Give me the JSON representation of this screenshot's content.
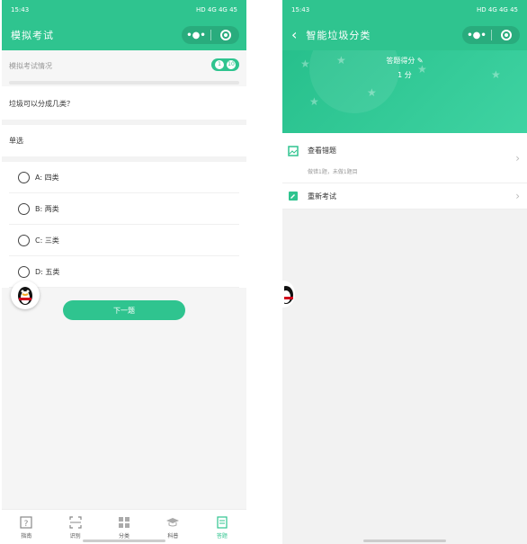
{
  "left": {
    "status_time": "15:43",
    "status_right": "HD 4G 4G 45",
    "title": "模拟考试",
    "exam_label": "模拟考试情况",
    "progress_current": "1",
    "progress_total": "10",
    "question": "垃圾可以分成几类？",
    "question_type": "单选",
    "options": [
      "A: 四类",
      "B: 两类",
      "C: 三类",
      "D: 五类"
    ],
    "next_label": "下一题",
    "tabs": [
      "指南",
      "识别",
      "分类",
      "科普",
      "答题"
    ]
  },
  "right": {
    "status_time": "15:43",
    "status_right": "HD 4G 4G 45",
    "title": "智能垃圾分类",
    "score_label": "答题得分",
    "score_value": "1 分",
    "menu": {
      "wrong_title": "查看错题",
      "wrong_sub": "做错1题，未做1题目",
      "retake_title": "重新考试"
    }
  },
  "colors": {
    "accent": "#2fc48f"
  }
}
